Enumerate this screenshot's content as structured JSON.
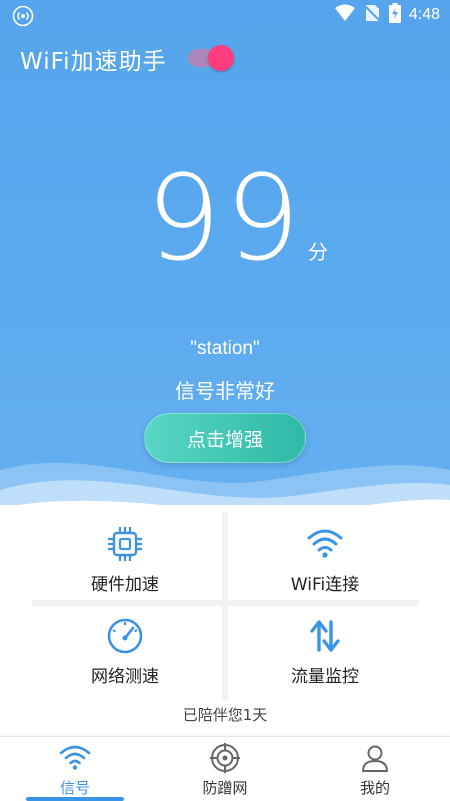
{
  "status_bar": {
    "time": "4:48",
    "icons": [
      "hotspot-icon",
      "wifi-signal-icon",
      "no-sim-icon",
      "battery-charging-icon"
    ]
  },
  "app": {
    "title": "WiFi加速助手",
    "toggle_on": true
  },
  "score": {
    "value": "99",
    "unit": "分"
  },
  "network": {
    "ssid": "\"station\"",
    "status": "信号非常好"
  },
  "boost_button": {
    "label": "点击增强"
  },
  "features": [
    {
      "label": "硬件加速",
      "icon": "chip-icon"
    },
    {
      "label": "WiFi连接",
      "icon": "wifi-icon"
    },
    {
      "label": "网络测速",
      "icon": "speedometer-icon"
    },
    {
      "label": "流量监控",
      "icon": "transfer-arrows-icon"
    }
  ],
  "companion_text": "已陪伴您1天",
  "tabs": [
    {
      "label": "信号",
      "icon": "wifi-icon",
      "active": true
    },
    {
      "label": "防蹭网",
      "icon": "target-icon",
      "active": false
    },
    {
      "label": "我的",
      "icon": "user-icon",
      "active": false
    }
  ],
  "colors": {
    "hero_blue": "#56a5ec",
    "accent_blue": "#3a94e6",
    "toggle_pink": "#ff3d7f",
    "button_teal": "#2eb9a6"
  }
}
